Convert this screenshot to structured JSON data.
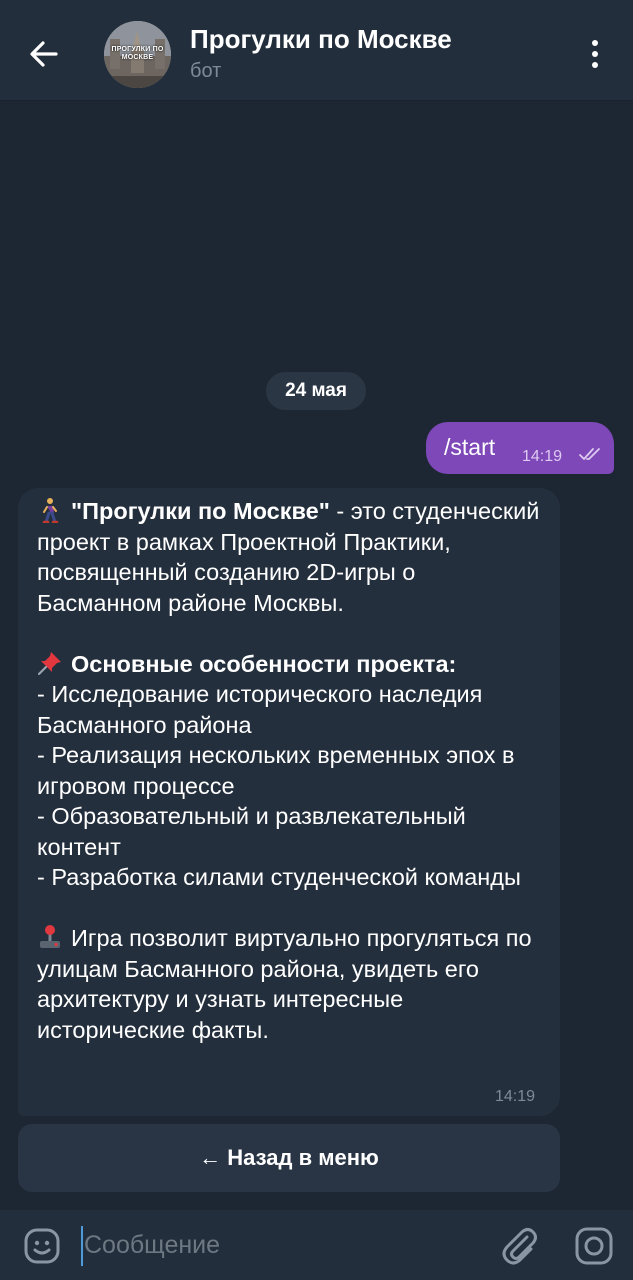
{
  "header": {
    "back_icon": "arrow-left-icon",
    "avatar_text": "ПРОГУЛКИ ПО МОСКВЕ",
    "title": "Прогулки по Москве",
    "subtitle": "бот",
    "menu_icon": "more-vertical-icon"
  },
  "chat": {
    "date_chip": "24 мая",
    "outgoing": {
      "text": "/start",
      "time": "14:19",
      "status_icon": "double-check-icon"
    },
    "incoming": {
      "p1_emoji": "person-walking-icon",
      "p1_bold": "\"Прогулки по Москве\"",
      "p1_rest": " - это студенческий проект в рамках Проектной Практики, посвященный созданию 2D-игры о Басманном районе Москвы.",
      "p2_emoji": "pushpin-icon",
      "p2_heading": "Основные особенности проекта:",
      "features": [
        "- Исследование исторического наследия Басманного района",
        "- Реализация нескольких временных эпох в игровом процессе",
        "- Образовательный и развлекательный контент",
        "- Разработка силами студенческой команды"
      ],
      "p3_emoji": "joystick-icon",
      "p3_text": "Игра позволит виртуально прогуляться по улицам Басманного района, увидеть его архитектуру и узнать интересные исторические факты.",
      "time": "14:19"
    },
    "keyboard_button": "← Назад в меню"
  },
  "input": {
    "placeholder": "Сообщение",
    "emoji_icon": "smile-icon",
    "attach_icon": "paperclip-icon",
    "camera_icon": "instagram-camera-icon"
  },
  "colors": {
    "background": "#1d2733",
    "header": "#232e3c",
    "outgoing_bubble": "#7f48b8",
    "incoming_bubble": "#242f3d",
    "accent": "#4e9bdb"
  }
}
